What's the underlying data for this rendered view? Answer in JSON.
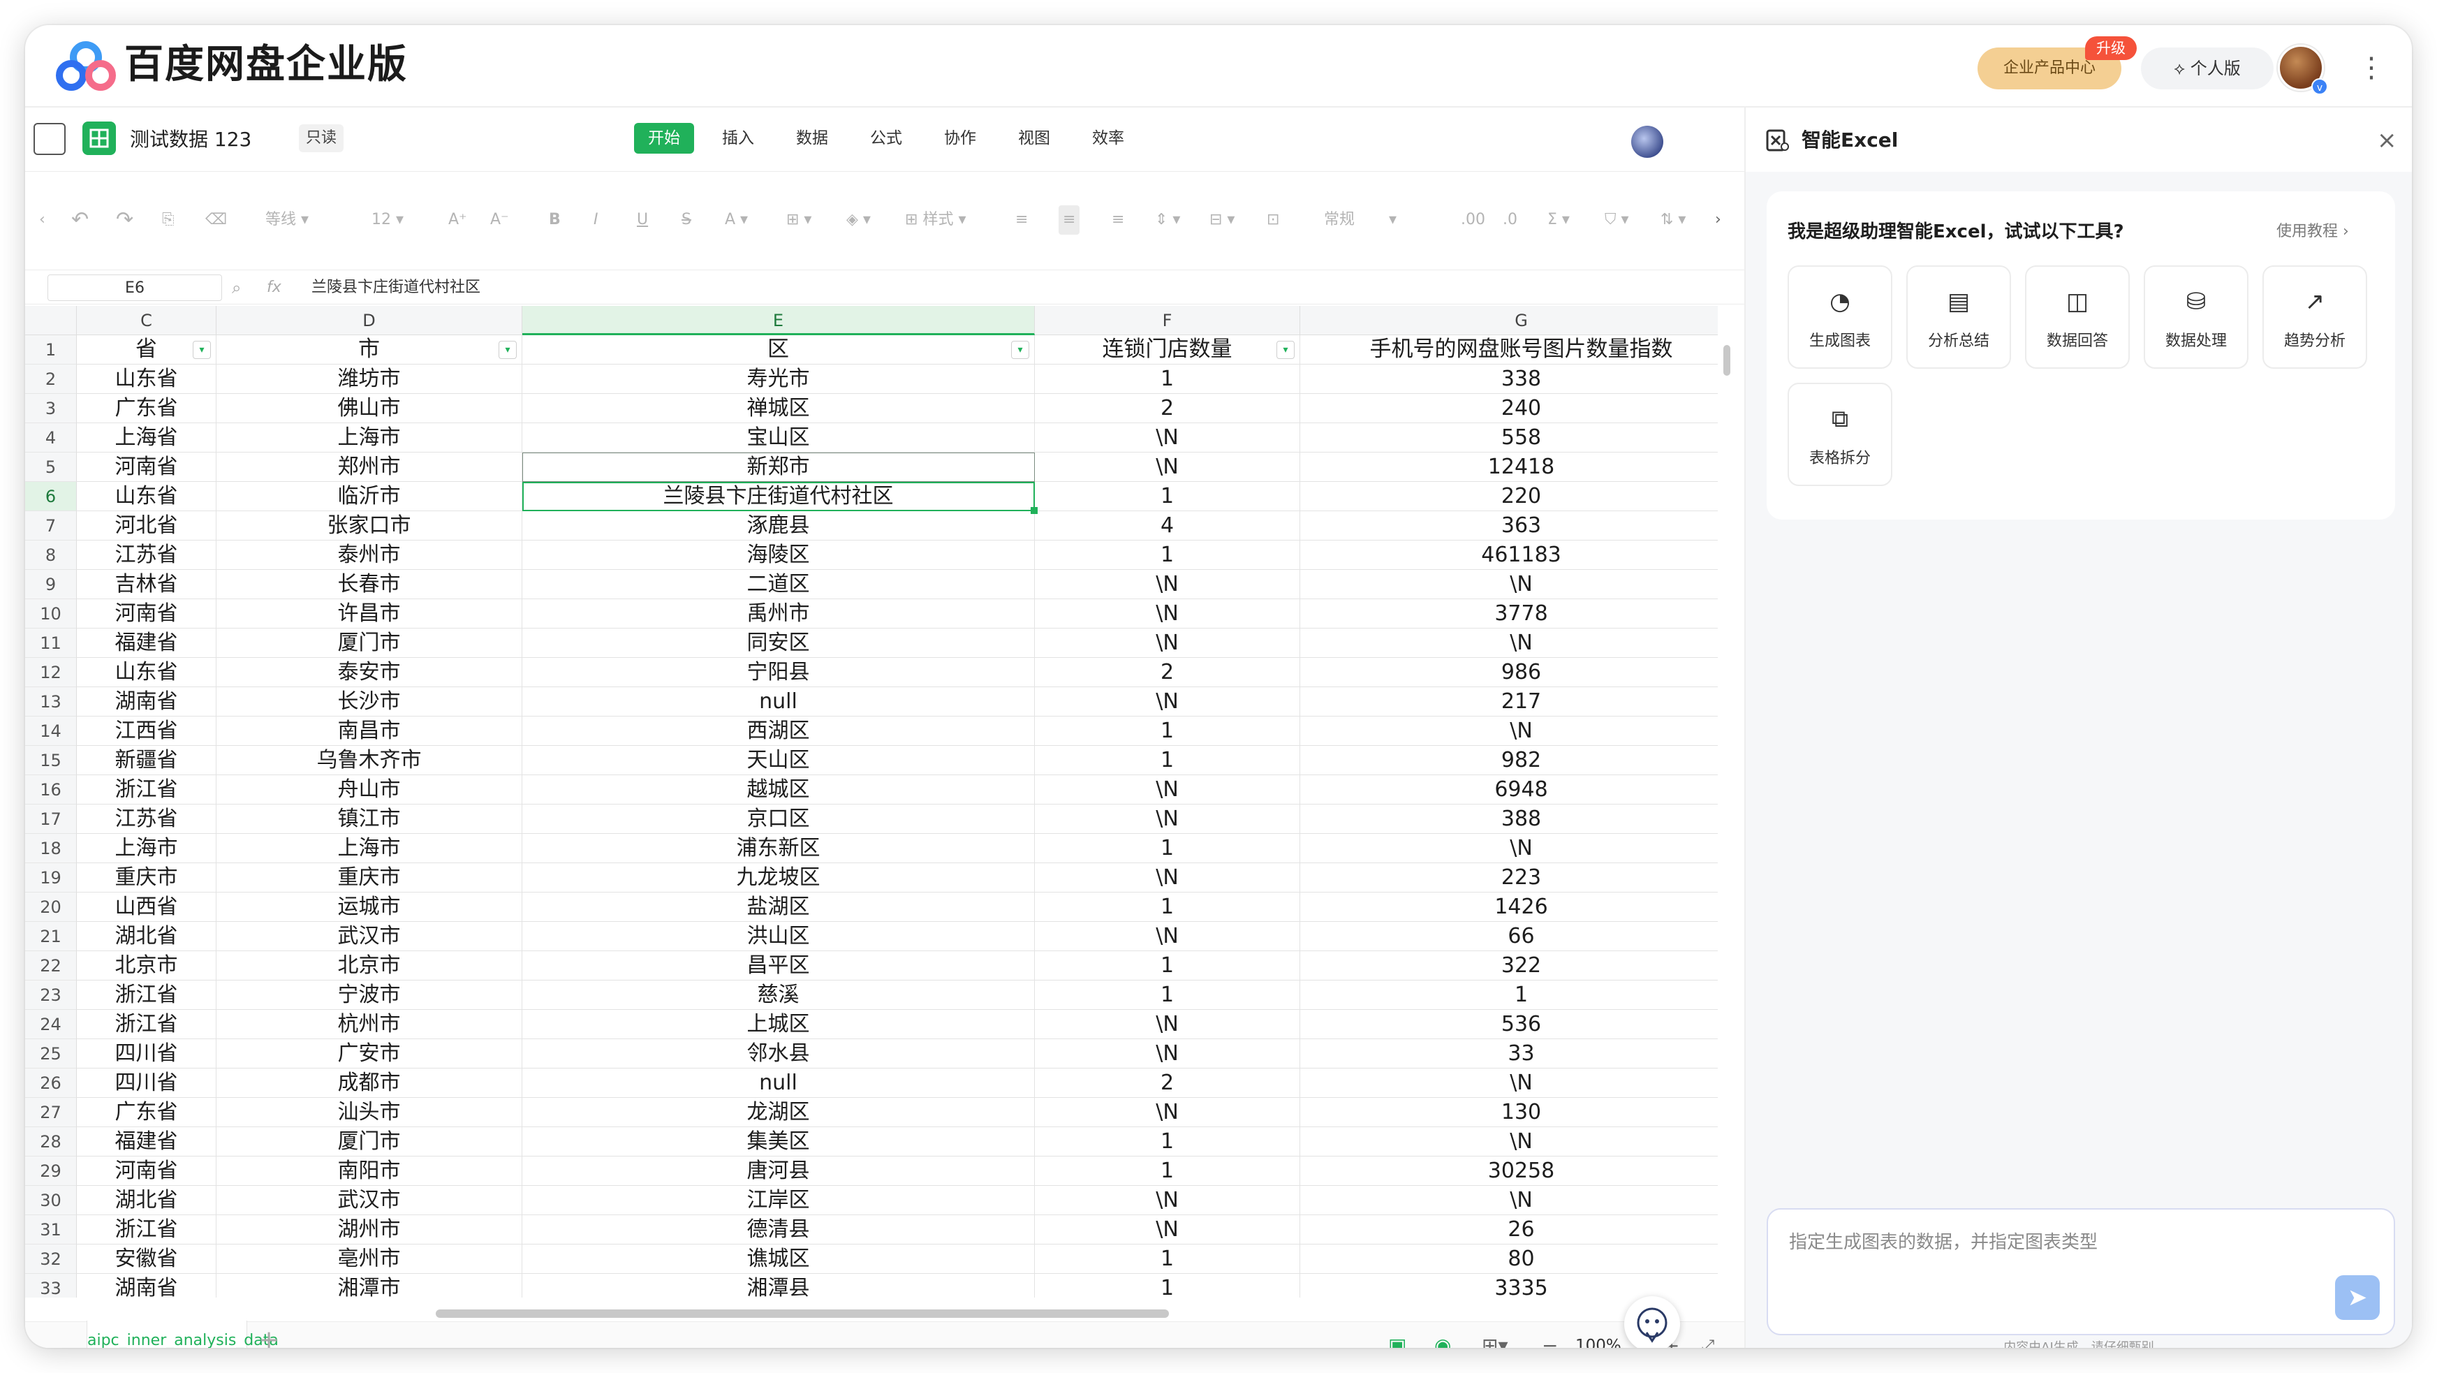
{
  "app": {
    "brand": "百度网盘企业版",
    "enterprise_center": "企业产品中心",
    "upgrade_badge": "升级",
    "personal_edition": "个人版",
    "more_icon": "more-vertical-icon"
  },
  "document": {
    "title": "测试数据 123",
    "readonly": "只读",
    "menu": [
      "开始",
      "插入",
      "数据",
      "公式",
      "协作",
      "视图",
      "效率"
    ],
    "active_menu": "开始"
  },
  "toolbar": {
    "font_name": "等线",
    "font_size": "12",
    "style_label": "样式",
    "number_format": "常规"
  },
  "formula_bar": {
    "cell_ref": "E6",
    "content": "兰陵县卞庄街道代村社区"
  },
  "grid": {
    "columns": [
      "C",
      "D",
      "E",
      "F",
      "G"
    ],
    "selected_column": "E",
    "selected_row": "6",
    "header_row": {
      "row": "1",
      "cells": [
        "省",
        "市",
        "区",
        "连锁门店数量",
        "手机号的网盘账号图片数量指数"
      ]
    },
    "rows": [
      {
        "n": "2",
        "c": [
          "山东省",
          "潍坊市",
          "寿光市",
          "1",
          "338"
        ]
      },
      {
        "n": "3",
        "c": [
          "广东省",
          "佛山市",
          "禅城区",
          "2",
          "240"
        ]
      },
      {
        "n": "4",
        "c": [
          "上海省",
          "上海市",
          "宝山区",
          "\\N",
          "558"
        ]
      },
      {
        "n": "5",
        "c": [
          "河南省",
          "郑州市",
          "新郑市",
          "\\N",
          "12418"
        ]
      },
      {
        "n": "6",
        "c": [
          "山东省",
          "临沂市",
          "兰陵县卞庄街道代村社区",
          "1",
          "220"
        ]
      },
      {
        "n": "7",
        "c": [
          "河北省",
          "张家口市",
          "涿鹿县",
          "4",
          "363"
        ]
      },
      {
        "n": "8",
        "c": [
          "江苏省",
          "泰州市",
          "海陵区",
          "1",
          "461183"
        ]
      },
      {
        "n": "9",
        "c": [
          "吉林省",
          "长春市",
          "二道区",
          "\\N",
          "\\N"
        ]
      },
      {
        "n": "10",
        "c": [
          "河南省",
          "许昌市",
          "禹州市",
          "\\N",
          "3778"
        ]
      },
      {
        "n": "11",
        "c": [
          "福建省",
          "厦门市",
          "同安区",
          "\\N",
          "\\N"
        ]
      },
      {
        "n": "12",
        "c": [
          "山东省",
          "泰安市",
          "宁阳县",
          "2",
          "986"
        ]
      },
      {
        "n": "13",
        "c": [
          "湖南省",
          "长沙市",
          "null",
          "\\N",
          "217"
        ]
      },
      {
        "n": "14",
        "c": [
          "江西省",
          "南昌市",
          "西湖区",
          "1",
          "\\N"
        ]
      },
      {
        "n": "15",
        "c": [
          "新疆省",
          "乌鲁木齐市",
          "天山区",
          "1",
          "982"
        ]
      },
      {
        "n": "16",
        "c": [
          "浙江省",
          "舟山市",
          "越城区",
          "\\N",
          "6948"
        ]
      },
      {
        "n": "17",
        "c": [
          "江苏省",
          "镇江市",
          "京口区",
          "\\N",
          "388"
        ]
      },
      {
        "n": "18",
        "c": [
          "上海市",
          "上海市",
          "浦东新区",
          "1",
          "\\N"
        ]
      },
      {
        "n": "19",
        "c": [
          "重庆市",
          "重庆市",
          "九龙坡区",
          "\\N",
          "223"
        ]
      },
      {
        "n": "20",
        "c": [
          "山西省",
          "运城市",
          "盐湖区",
          "1",
          "1426"
        ]
      },
      {
        "n": "21",
        "c": [
          "湖北省",
          "武汉市",
          "洪山区",
          "\\N",
          "66"
        ]
      },
      {
        "n": "22",
        "c": [
          "北京市",
          "北京市",
          "昌平区",
          "1",
          "322"
        ]
      },
      {
        "n": "23",
        "c": [
          "浙江省",
          "宁波市",
          "慈溪",
          "1",
          "1"
        ]
      },
      {
        "n": "24",
        "c": [
          "浙江省",
          "杭州市",
          "上城区",
          "\\N",
          "536"
        ]
      },
      {
        "n": "25",
        "c": [
          "四川省",
          "广安市",
          "邻水县",
          "\\N",
          "33"
        ]
      },
      {
        "n": "26",
        "c": [
          "四川省",
          "成都市",
          "null",
          "2",
          "\\N"
        ]
      },
      {
        "n": "27",
        "c": [
          "广东省",
          "汕头市",
          "龙湖区",
          "\\N",
          "130"
        ]
      },
      {
        "n": "28",
        "c": [
          "福建省",
          "厦门市",
          "集美区",
          "1",
          "\\N"
        ]
      },
      {
        "n": "29",
        "c": [
          "河南省",
          "南阳市",
          "唐河县",
          "1",
          "30258"
        ]
      },
      {
        "n": "30",
        "c": [
          "湖北省",
          "武汉市",
          "江岸区",
          "\\N",
          "\\N"
        ]
      },
      {
        "n": "31",
        "c": [
          "浙江省",
          "湖州市",
          "德清县",
          "\\N",
          "26"
        ]
      },
      {
        "n": "32",
        "c": [
          "安徽省",
          "亳州市",
          "谯城区",
          "1",
          "80"
        ]
      },
      {
        "n": "33",
        "c": [
          "湖南省",
          "湘潭市",
          "湘潭县",
          "1",
          "3335"
        ]
      }
    ]
  },
  "bottom_bar": {
    "sheet_tab": "aipc_inner_analysis_data",
    "zoom": "100%"
  },
  "ai_panel": {
    "title": "智能Excel",
    "greeting": "我是超级助理智能Excel，试试以下工具?",
    "tutorial_link": "使用教程",
    "tools": [
      {
        "label": "生成图表",
        "icon": "pie-chart-icon"
      },
      {
        "label": "分析总结",
        "icon": "document-search-icon"
      },
      {
        "label": "数据回答",
        "icon": "chat-chart-icon"
      },
      {
        "label": "数据处理",
        "icon": "database-icon"
      },
      {
        "label": "趋势分析",
        "icon": "trend-chart-icon"
      },
      {
        "label": "表格拆分",
        "icon": "split-table-icon"
      }
    ],
    "input_placeholder": "指定生成图表的数据，并指定图表类型",
    "disclaimer": "内容由AI生成，请仔细甄别"
  },
  "colors": {
    "accent_green": "#20b15a",
    "enterprise_gold": "#f4cf93",
    "upgrade_red": "#f5523a",
    "send_blue": "#9cc0f4"
  }
}
